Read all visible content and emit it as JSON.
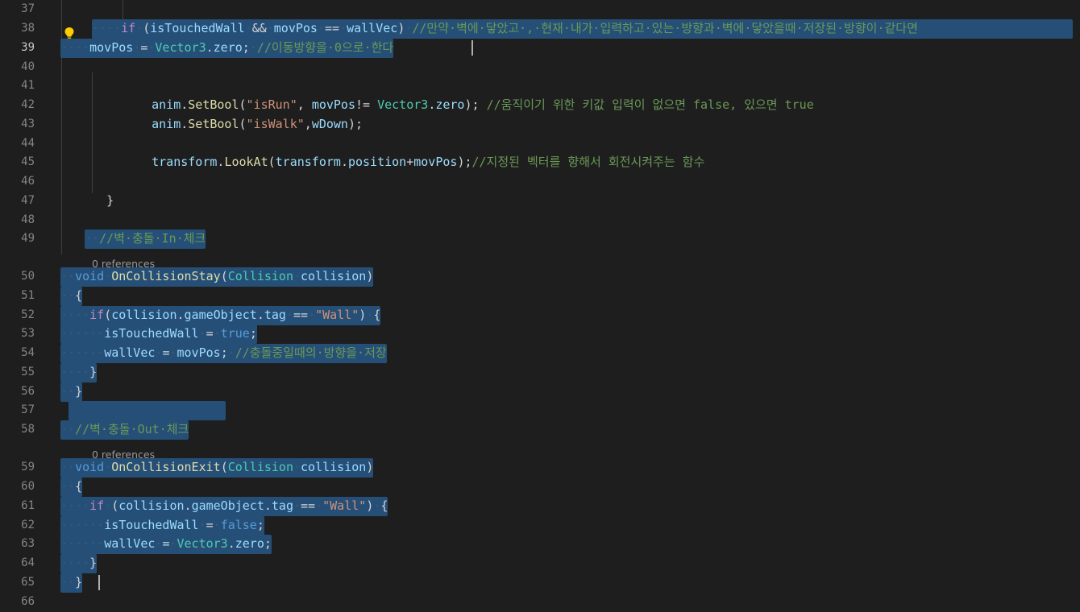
{
  "lines": [
    {
      "n": "37",
      "t": []
    },
    {
      "n": "38",
      "t": [
        {
          "c": "ws",
          "v": "····"
        },
        {
          "c": "ctl",
          "v": "if"
        },
        {
          "c": "ws",
          "v": "·"
        },
        {
          "c": "pl",
          "v": "("
        },
        {
          "c": "var",
          "v": "isTouchedWall"
        },
        {
          "c": "ws",
          "v": "·"
        },
        {
          "c": "pl",
          "v": "&&"
        },
        {
          "c": "ws",
          "v": "·"
        },
        {
          "c": "var",
          "v": "movPos"
        },
        {
          "c": "ws",
          "v": "·"
        },
        {
          "c": "pl",
          "v": "=="
        },
        {
          "c": "ws",
          "v": "·"
        },
        {
          "c": "var",
          "v": "wallVec"
        },
        {
          "c": "pl",
          "v": ")"
        },
        {
          "c": "ws",
          "v": "·"
        },
        {
          "c": "cm",
          "v": "//만약·벽에·닿았고·,·현재·내가·입력하고·있는·방향과·벽에·닿았을때·저장된·방향이·같다면"
        }
      ]
    },
    {
      "n": "39",
      "t": [
        {
          "c": "ws",
          "v": "····"
        },
        {
          "c": "var",
          "v": "movPos"
        },
        {
          "c": "ws",
          "v": "·"
        },
        {
          "c": "pl",
          "v": "="
        },
        {
          "c": "ws",
          "v": "·"
        },
        {
          "c": "ty",
          "v": "Vector3"
        },
        {
          "c": "pl",
          "v": "."
        },
        {
          "c": "var",
          "v": "zero"
        },
        {
          "c": "pl",
          "v": ";"
        },
        {
          "c": "ws",
          "v": "·"
        },
        {
          "c": "cm",
          "v": "//이동방향을·0으로·한다"
        }
      ]
    },
    {
      "n": "40",
      "t": []
    },
    {
      "n": "41",
      "t": []
    },
    {
      "n": "42",
      "t": [
        {
          "c": "ws",
          "v": "    "
        },
        {
          "c": "var",
          "v": "anim"
        },
        {
          "c": "pl",
          "v": "."
        },
        {
          "c": "fn",
          "v": "SetBool"
        },
        {
          "c": "pl",
          "v": "("
        },
        {
          "c": "str",
          "v": "\"isRun\""
        },
        {
          "c": "pl",
          "v": ", "
        },
        {
          "c": "var",
          "v": "movPos"
        },
        {
          "c": "pl",
          "v": "!= "
        },
        {
          "c": "ty",
          "v": "Vector3"
        },
        {
          "c": "pl",
          "v": "."
        },
        {
          "c": "var",
          "v": "zero"
        },
        {
          "c": "pl",
          "v": "); "
        },
        {
          "c": "cm",
          "v": "//움직이기 위한 키값 입력이 없으면 false, 있으면 true"
        }
      ]
    },
    {
      "n": "43",
      "t": [
        {
          "c": "ws",
          "v": "    "
        },
        {
          "c": "var",
          "v": "anim"
        },
        {
          "c": "pl",
          "v": "."
        },
        {
          "c": "fn",
          "v": "SetBool"
        },
        {
          "c": "pl",
          "v": "("
        },
        {
          "c": "str",
          "v": "\"isWalk\""
        },
        {
          "c": "pl",
          "v": ","
        },
        {
          "c": "var",
          "v": "wDown"
        },
        {
          "c": "pl",
          "v": ");"
        }
      ]
    },
    {
      "n": "44",
      "t": []
    },
    {
      "n": "45",
      "t": [
        {
          "c": "ws",
          "v": "    "
        },
        {
          "c": "var",
          "v": "transform"
        },
        {
          "c": "pl",
          "v": "."
        },
        {
          "c": "fn",
          "v": "LookAt"
        },
        {
          "c": "pl",
          "v": "("
        },
        {
          "c": "var",
          "v": "transform"
        },
        {
          "c": "pl",
          "v": "."
        },
        {
          "c": "var",
          "v": "position"
        },
        {
          "c": "pl",
          "v": "+"
        },
        {
          "c": "var",
          "v": "movPos"
        },
        {
          "c": "pl",
          "v": ");"
        },
        {
          "c": "cm",
          "v": "//지정된 벡터를 향해서 회전시켜주는 함수"
        }
      ]
    },
    {
      "n": "46",
      "t": []
    },
    {
      "n": "47",
      "t": [
        {
          "c": "ws",
          "v": "  "
        },
        {
          "c": "pl",
          "v": "}"
        }
      ]
    },
    {
      "n": "48",
      "t": []
    },
    {
      "n": "49",
      "t": [
        {
          "c": "ws",
          "v": "··"
        },
        {
          "c": "cm",
          "v": "//벽·충돌·In·체크"
        }
      ]
    },
    {
      "n": "50",
      "t": [
        {
          "c": "ws",
          "v": "··"
        },
        {
          "c": "kw",
          "v": "void"
        },
        {
          "c": "ws",
          "v": "·"
        },
        {
          "c": "fn",
          "v": "OnCollisionStay"
        },
        {
          "c": "pl",
          "v": "("
        },
        {
          "c": "ty",
          "v": "Collision"
        },
        {
          "c": "ws",
          "v": "·"
        },
        {
          "c": "var",
          "v": "collision"
        },
        {
          "c": "pl",
          "v": ")"
        }
      ]
    },
    {
      "n": "51",
      "t": [
        {
          "c": "ws",
          "v": "··"
        },
        {
          "c": "pl",
          "v": "{"
        }
      ]
    },
    {
      "n": "52",
      "t": [
        {
          "c": "ws",
          "v": "····"
        },
        {
          "c": "ctl",
          "v": "if"
        },
        {
          "c": "pl",
          "v": "("
        },
        {
          "c": "var",
          "v": "collision"
        },
        {
          "c": "pl",
          "v": "."
        },
        {
          "c": "var",
          "v": "gameObject"
        },
        {
          "c": "pl",
          "v": "."
        },
        {
          "c": "var",
          "v": "tag"
        },
        {
          "c": "ws",
          "v": "·"
        },
        {
          "c": "pl",
          "v": "=="
        },
        {
          "c": "ws",
          "v": "·"
        },
        {
          "c": "str",
          "v": "\"Wall\""
        },
        {
          "c": "pl",
          "v": ")"
        },
        {
          "c": "ws",
          "v": "·"
        },
        {
          "c": "pl",
          "v": "{"
        }
      ]
    },
    {
      "n": "53",
      "t": [
        {
          "c": "ws",
          "v": "······"
        },
        {
          "c": "var",
          "v": "isTouchedWall"
        },
        {
          "c": "ws",
          "v": "·"
        },
        {
          "c": "pl",
          "v": "="
        },
        {
          "c": "ws",
          "v": "·"
        },
        {
          "c": "kw",
          "v": "true"
        },
        {
          "c": "pl",
          "v": ";"
        }
      ]
    },
    {
      "n": "54",
      "t": [
        {
          "c": "ws",
          "v": "······"
        },
        {
          "c": "var",
          "v": "wallVec"
        },
        {
          "c": "ws",
          "v": "·"
        },
        {
          "c": "pl",
          "v": "="
        },
        {
          "c": "ws",
          "v": "·"
        },
        {
          "c": "var",
          "v": "movPos"
        },
        {
          "c": "pl",
          "v": ";"
        },
        {
          "c": "ws",
          "v": "·"
        },
        {
          "c": "cm",
          "v": "//충돌중일때의·방향을·저장"
        }
      ]
    },
    {
      "n": "55",
      "t": [
        {
          "c": "ws",
          "v": "····"
        },
        {
          "c": "pl",
          "v": "}"
        }
      ]
    },
    {
      "n": "56",
      "t": [
        {
          "c": "ws",
          "v": "··"
        },
        {
          "c": "pl",
          "v": "}"
        }
      ]
    },
    {
      "n": "57",
      "t": []
    },
    {
      "n": "58",
      "t": [
        {
          "c": "ws",
          "v": "··"
        },
        {
          "c": "cm",
          "v": "//벽·충돌·Out·체크"
        }
      ]
    },
    {
      "n": "59",
      "t": [
        {
          "c": "ws",
          "v": "··"
        },
        {
          "c": "kw",
          "v": "void"
        },
        {
          "c": "ws",
          "v": "·"
        },
        {
          "c": "fn",
          "v": "OnCollisionExit"
        },
        {
          "c": "pl",
          "v": "("
        },
        {
          "c": "ty",
          "v": "Collision"
        },
        {
          "c": "ws",
          "v": "·"
        },
        {
          "c": "var",
          "v": "collision"
        },
        {
          "c": "pl",
          "v": ")"
        }
      ]
    },
    {
      "n": "60",
      "t": [
        {
          "c": "ws",
          "v": "··"
        },
        {
          "c": "pl",
          "v": "{"
        }
      ]
    },
    {
      "n": "61",
      "t": [
        {
          "c": "ws",
          "v": "····"
        },
        {
          "c": "ctl",
          "v": "if"
        },
        {
          "c": "ws",
          "v": "·"
        },
        {
          "c": "pl",
          "v": "("
        },
        {
          "c": "var",
          "v": "collision"
        },
        {
          "c": "pl",
          "v": "."
        },
        {
          "c": "var",
          "v": "gameObject"
        },
        {
          "c": "pl",
          "v": "."
        },
        {
          "c": "var",
          "v": "tag"
        },
        {
          "c": "ws",
          "v": "·"
        },
        {
          "c": "pl",
          "v": "=="
        },
        {
          "c": "ws",
          "v": "·"
        },
        {
          "c": "str",
          "v": "\"Wall\""
        },
        {
          "c": "pl",
          "v": ")"
        },
        {
          "c": "ws",
          "v": "·"
        },
        {
          "c": "pl",
          "v": "{"
        }
      ]
    },
    {
      "n": "62",
      "t": [
        {
          "c": "ws",
          "v": "······"
        },
        {
          "c": "var",
          "v": "isTouchedWall"
        },
        {
          "c": "ws",
          "v": "·"
        },
        {
          "c": "pl",
          "v": "="
        },
        {
          "c": "ws",
          "v": "·"
        },
        {
          "c": "kw",
          "v": "false"
        },
        {
          "c": "pl",
          "v": ";"
        }
      ]
    },
    {
      "n": "63",
      "t": [
        {
          "c": "ws",
          "v": "······"
        },
        {
          "c": "var",
          "v": "wallVec"
        },
        {
          "c": "ws",
          "v": "·"
        },
        {
          "c": "pl",
          "v": "="
        },
        {
          "c": "ws",
          "v": "·"
        },
        {
          "c": "ty",
          "v": "Vector3"
        },
        {
          "c": "pl",
          "v": "."
        },
        {
          "c": "var",
          "v": "zero"
        },
        {
          "c": "pl",
          "v": ";"
        }
      ]
    },
    {
      "n": "64",
      "t": [
        {
          "c": "ws",
          "v": "····"
        },
        {
          "c": "pl",
          "v": "}"
        }
      ]
    },
    {
      "n": "65",
      "t": [
        {
          "c": "ws",
          "v": "··"
        },
        {
          "c": "pl",
          "v": "}"
        }
      ]
    },
    {
      "n": "66",
      "t": []
    }
  ],
  "codelens": {
    "on_collision_stay": "0 references",
    "on_collision_exit": "0 references"
  },
  "colors": {
    "background": "#1e1e1e",
    "selection": "#264f78",
    "keyword": "#569cd6",
    "control": "#c586c0",
    "type": "#4ec9b0",
    "function": "#dcdcaa",
    "variable": "#9cdcfe",
    "string": "#ce9178",
    "comment": "#6a9955"
  },
  "icons": {
    "lightbulb": "lightbulb-icon"
  }
}
